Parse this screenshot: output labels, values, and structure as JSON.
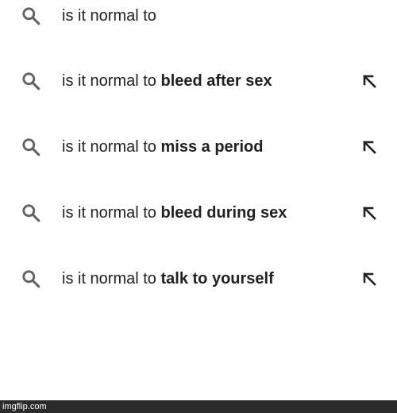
{
  "search": {
    "query": "is it normal to",
    "icon": "search-icon"
  },
  "suggestions": [
    {
      "prefix": "is it normal to",
      "completion": "bleed after sex",
      "icon": "search-icon",
      "action_icon": "arrow-up-left-icon"
    },
    {
      "prefix": "is it normal to",
      "completion": "miss a period",
      "icon": "search-icon",
      "action_icon": "arrow-up-left-icon"
    },
    {
      "prefix": "is it normal to",
      "completion": "bleed during sex",
      "icon": "search-icon",
      "action_icon": "arrow-up-left-icon"
    },
    {
      "prefix": "is it normal to",
      "completion": "talk to yourself",
      "icon": "search-icon",
      "action_icon": "arrow-up-left-icon"
    }
  ],
  "watermark": {
    "text": "imgflip.com"
  },
  "colors": {
    "text": "#202124",
    "icon": "#5f6368",
    "background": "#ffffff",
    "watermark_bar": "#2b2b2b"
  }
}
